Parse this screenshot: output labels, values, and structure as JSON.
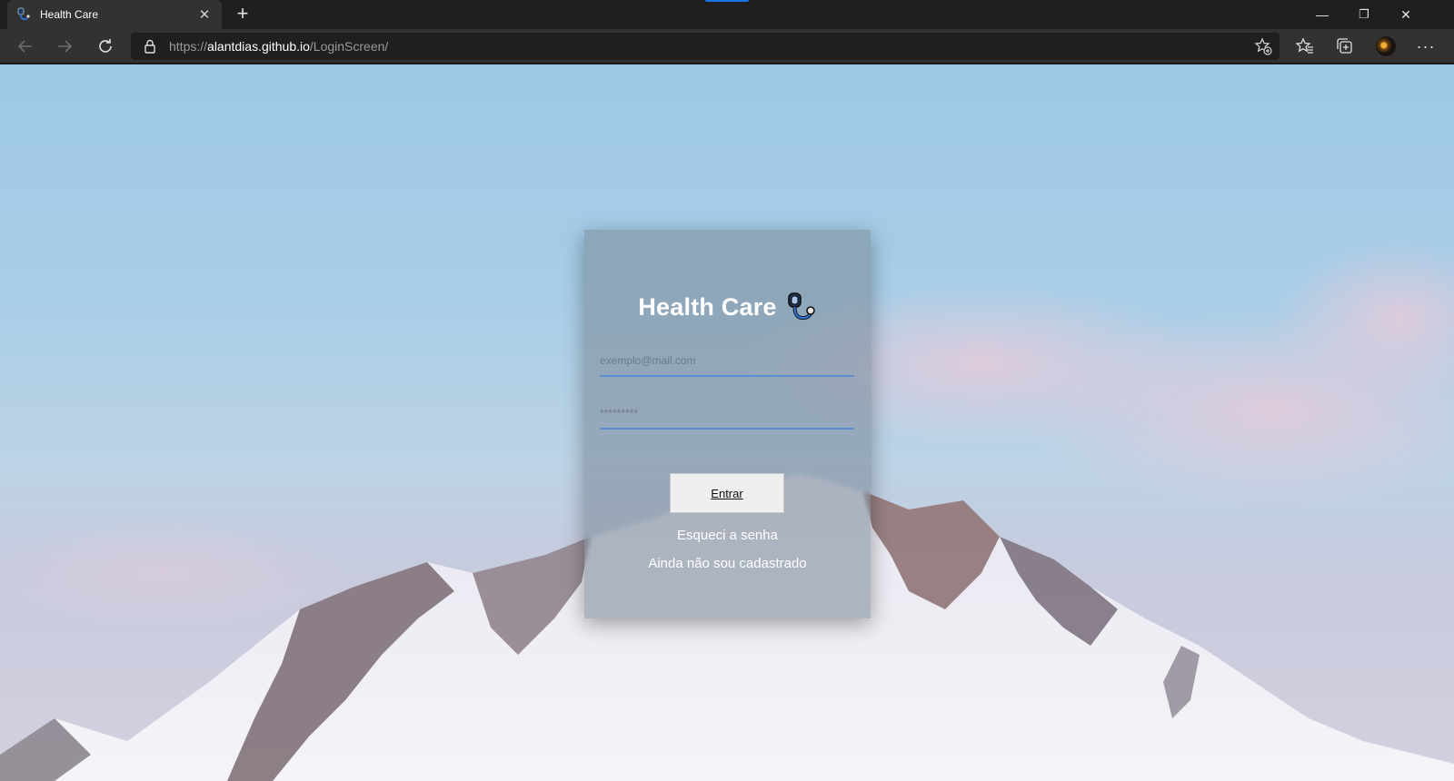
{
  "browser": {
    "tab": {
      "title": "Health Care",
      "favicon": "stethoscope-icon"
    },
    "url": {
      "scheme": "https://",
      "host": "alantdias.github.io",
      "path": "/LoginScreen/"
    },
    "icons": {
      "back": "arrow-left-icon",
      "forward": "arrow-right-icon",
      "reload": "refresh-icon",
      "lock": "lock-icon",
      "add_favorite": "star-add-icon",
      "favorites": "favorites-icon",
      "collections": "collections-icon",
      "profile": "avatar",
      "menu": "more-icon"
    },
    "window_controls": {
      "minimize": "—",
      "restore": "❐",
      "close": "✕"
    },
    "accent_color": "#1a73e8"
  },
  "login": {
    "title": "Health Care",
    "title_icon": "stethoscope-icon",
    "email_placeholder": "exemplo@mail.com",
    "password_placeholder": "*********",
    "submit_label": "Entrar",
    "forgot_password": "Esqueci a senha",
    "register": "Ainda não sou cadastrado",
    "underline_color": "#5b8ed0"
  }
}
